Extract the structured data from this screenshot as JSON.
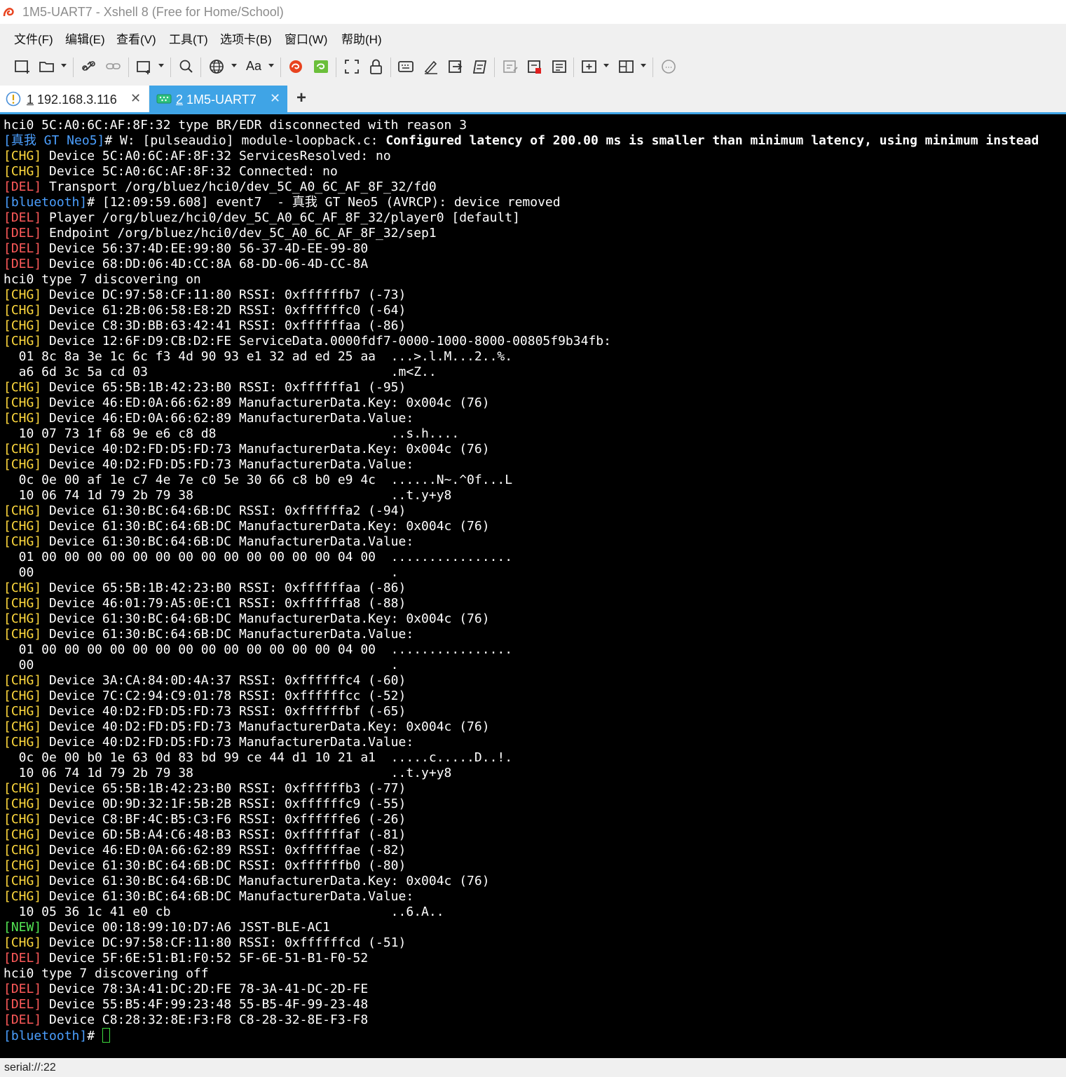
{
  "window": {
    "title": "1M5-UART7 - Xshell 8 (Free for Home/School)",
    "app_icon": "xshell-snail-icon"
  },
  "menu": [
    {
      "label": "文件(F)"
    },
    {
      "label": "编辑(E)"
    },
    {
      "label": "查看(V)"
    },
    {
      "label": "工具(T)"
    },
    {
      "label": "选项卡(B)"
    },
    {
      "label": "窗口(W)"
    },
    {
      "label": "帮助(H)"
    }
  ],
  "toolbar": {
    "font_label": "Aa"
  },
  "tabs": [
    {
      "number": "1",
      "label": "192.168.3.116",
      "icon": "warning-circle-icon",
      "active": false
    },
    {
      "number": "2",
      "label": "1M5-UART7",
      "icon": "serial-port-icon",
      "active": true
    }
  ],
  "tab_add": "+",
  "terminal": {
    "lines": [
      [
        {
          "t": "hci0 5C:A0:6C:AF:8F:32 type BR/EDR disconnected with reason 3"
        }
      ],
      [
        {
          "t": "[真我 GT Neo5]",
          "c": "blue"
        },
        {
          "t": "# W: [pulseaudio] module-loopback.c: "
        },
        {
          "t": "Configured latency of 200.00 ms is smaller than minimum latency, using minimum instead",
          "b": true
        }
      ],
      [
        {
          "t": "[CHG]",
          "c": "yellow"
        },
        {
          "t": " Device 5C:A0:6C:AF:8F:32 ServicesResolved: no"
        }
      ],
      [
        {
          "t": "[CHG]",
          "c": "yellow"
        },
        {
          "t": " Device 5C:A0:6C:AF:8F:32 Connected: no"
        }
      ],
      [
        {
          "t": "[DEL]",
          "c": "red"
        },
        {
          "t": " Transport /org/bluez/hci0/dev_5C_A0_6C_AF_8F_32/fd0"
        }
      ],
      [
        {
          "t": "[bluetooth]",
          "c": "blue"
        },
        {
          "t": "# [12:09:59.608] event7  - 真我 GT Neo5 (AVRCP): device removed"
        }
      ],
      [
        {
          "t": "[DEL]",
          "c": "red"
        },
        {
          "t": " Player /org/bluez/hci0/dev_5C_A0_6C_AF_8F_32/player0 [default]"
        }
      ],
      [
        {
          "t": "[DEL]",
          "c": "red"
        },
        {
          "t": " Endpoint /org/bluez/hci0/dev_5C_A0_6C_AF_8F_32/sep1"
        }
      ],
      [
        {
          "t": "[DEL]",
          "c": "red"
        },
        {
          "t": " Device 56:37:4D:EE:99:80 56-37-4D-EE-99-80"
        }
      ],
      [
        {
          "t": "[DEL]",
          "c": "red"
        },
        {
          "t": " Device 68:DD:06:4D:CC:8A 68-DD-06-4D-CC-8A"
        }
      ],
      [
        {
          "t": "hci0 type 7 discovering on"
        }
      ],
      [
        {
          "t": "[CHG]",
          "c": "yellow"
        },
        {
          "t": " Device DC:97:58:CF:11:80 RSSI: 0xffffffb7 (-73)"
        }
      ],
      [
        {
          "t": "[CHG]",
          "c": "yellow"
        },
        {
          "t": " Device 61:2B:06:58:E8:2D RSSI: 0xffffffc0 (-64)"
        }
      ],
      [
        {
          "t": "[CHG]",
          "c": "yellow"
        },
        {
          "t": " Device C8:3D:BB:63:42:41 RSSI: 0xffffffaa (-86)"
        }
      ],
      [
        {
          "t": "[CHG]",
          "c": "yellow"
        },
        {
          "t": " Device 12:6F:D9:CB:D2:FE ServiceData.0000fdf7-0000-1000-8000-00805f9b34fb:"
        }
      ],
      [
        {
          "t": "  01 8c 8a 3e 1c 6c f3 4d 90 93 e1 32 ad ed 25 aa  ...>.l.M...2..%."
        }
      ],
      [
        {
          "t": "  a6 6d 3c 5a cd 03                                .m<Z.."
        }
      ],
      [
        {
          "t": "[CHG]",
          "c": "yellow"
        },
        {
          "t": " Device 65:5B:1B:42:23:B0 RSSI: 0xffffffa1 (-95)"
        }
      ],
      [
        {
          "t": "[CHG]",
          "c": "yellow"
        },
        {
          "t": " Device 46:ED:0A:66:62:89 ManufacturerData.Key: 0x004c (76)"
        }
      ],
      [
        {
          "t": "[CHG]",
          "c": "yellow"
        },
        {
          "t": " Device 46:ED:0A:66:62:89 ManufacturerData.Value:"
        }
      ],
      [
        {
          "t": "  10 07 73 1f 68 9e e6 c8 d8                       ..s.h...."
        }
      ],
      [
        {
          "t": "[CHG]",
          "c": "yellow"
        },
        {
          "t": " Device 40:D2:FD:D5:FD:73 ManufacturerData.Key: 0x004c (76)"
        }
      ],
      [
        {
          "t": "[CHG]",
          "c": "yellow"
        },
        {
          "t": " Device 40:D2:FD:D5:FD:73 ManufacturerData.Value:"
        }
      ],
      [
        {
          "t": "  0c 0e 00 af 1e c7 4e 7e c0 5e 30 66 c8 b0 e9 4c  ......N~.^0f...L"
        }
      ],
      [
        {
          "t": "  10 06 74 1d 79 2b 79 38                          ..t.y+y8"
        }
      ],
      [
        {
          "t": "[CHG]",
          "c": "yellow"
        },
        {
          "t": " Device 61:30:BC:64:6B:DC RSSI: 0xffffffa2 (-94)"
        }
      ],
      [
        {
          "t": "[CHG]",
          "c": "yellow"
        },
        {
          "t": " Device 61:30:BC:64:6B:DC ManufacturerData.Key: 0x004c (76)"
        }
      ],
      [
        {
          "t": "[CHG]",
          "c": "yellow"
        },
        {
          "t": " Device 61:30:BC:64:6B:DC ManufacturerData.Value:"
        }
      ],
      [
        {
          "t": "  01 00 00 00 00 00 00 00 00 00 00 00 00 00 04 00  ................"
        }
      ],
      [
        {
          "t": "  00                                               ."
        }
      ],
      [
        {
          "t": "[CHG]",
          "c": "yellow"
        },
        {
          "t": " Device 65:5B:1B:42:23:B0 RSSI: 0xffffffaa (-86)"
        }
      ],
      [
        {
          "t": "[CHG]",
          "c": "yellow"
        },
        {
          "t": " Device 46:01:79:A5:0E:C1 RSSI: 0xffffffa8 (-88)"
        }
      ],
      [
        {
          "t": "[CHG]",
          "c": "yellow"
        },
        {
          "t": " Device 61:30:BC:64:6B:DC ManufacturerData.Key: 0x004c (76)"
        }
      ],
      [
        {
          "t": "[CHG]",
          "c": "yellow"
        },
        {
          "t": " Device 61:30:BC:64:6B:DC ManufacturerData.Value:"
        }
      ],
      [
        {
          "t": "  01 00 00 00 00 00 00 00 00 00 00 00 00 00 04 00  ................"
        }
      ],
      [
        {
          "t": "  00                                               ."
        }
      ],
      [
        {
          "t": "[CHG]",
          "c": "yellow"
        },
        {
          "t": " Device 3A:CA:84:0D:4A:37 RSSI: 0xffffffc4 (-60)"
        }
      ],
      [
        {
          "t": "[CHG]",
          "c": "yellow"
        },
        {
          "t": " Device 7C:C2:94:C9:01:78 RSSI: 0xffffffcc (-52)"
        }
      ],
      [
        {
          "t": "[CHG]",
          "c": "yellow"
        },
        {
          "t": " Device 40:D2:FD:D5:FD:73 RSSI: 0xffffffbf (-65)"
        }
      ],
      [
        {
          "t": "[CHG]",
          "c": "yellow"
        },
        {
          "t": " Device 40:D2:FD:D5:FD:73 ManufacturerData.Key: 0x004c (76)"
        }
      ],
      [
        {
          "t": "[CHG]",
          "c": "yellow"
        },
        {
          "t": " Device 40:D2:FD:D5:FD:73 ManufacturerData.Value:"
        }
      ],
      [
        {
          "t": "  0c 0e 00 b0 1e 63 0d 83 bd 99 ce 44 d1 10 21 a1  .....c.....D..!."
        }
      ],
      [
        {
          "t": "  10 06 74 1d 79 2b 79 38                          ..t.y+y8"
        }
      ],
      [
        {
          "t": "[CHG]",
          "c": "yellow"
        },
        {
          "t": " Device 65:5B:1B:42:23:B0 RSSI: 0xffffffb3 (-77)"
        }
      ],
      [
        {
          "t": "[CHG]",
          "c": "yellow"
        },
        {
          "t": " Device 0D:9D:32:1F:5B:2B RSSI: 0xffffffc9 (-55)"
        }
      ],
      [
        {
          "t": "[CHG]",
          "c": "yellow"
        },
        {
          "t": " Device C8:BF:4C:B5:C3:F6 RSSI: 0xffffffe6 (-26)"
        }
      ],
      [
        {
          "t": "[CHG]",
          "c": "yellow"
        },
        {
          "t": " Device 6D:5B:A4:C6:48:B3 RSSI: 0xffffffaf (-81)"
        }
      ],
      [
        {
          "t": "[CHG]",
          "c": "yellow"
        },
        {
          "t": " Device 46:ED:0A:66:62:89 RSSI: 0xffffffae (-82)"
        }
      ],
      [
        {
          "t": "[CHG]",
          "c": "yellow"
        },
        {
          "t": " Device 61:30:BC:64:6B:DC RSSI: 0xffffffb0 (-80)"
        }
      ],
      [
        {
          "t": "[CHG]",
          "c": "yellow"
        },
        {
          "t": " Device 61:30:BC:64:6B:DC ManufacturerData.Key: 0x004c (76)"
        }
      ],
      [
        {
          "t": "[CHG]",
          "c": "yellow"
        },
        {
          "t": " Device 61:30:BC:64:6B:DC ManufacturerData.Value:"
        }
      ],
      [
        {
          "t": "  10 05 36 1c 41 e0 cb                             ..6.A.."
        }
      ],
      [
        {
          "t": "[NEW]",
          "c": "green"
        },
        {
          "t": " Device 00:18:99:10:D7:A6 JSST-BLE-AC1"
        }
      ],
      [
        {
          "t": "[CHG]",
          "c": "yellow"
        },
        {
          "t": " Device DC:97:58:CF:11:80 RSSI: 0xffffffcd (-51)"
        }
      ],
      [
        {
          "t": "[DEL]",
          "c": "red"
        },
        {
          "t": " Device 5F:6E:51:B1:F0:52 5F-6E-51-B1-F0-52"
        }
      ],
      [
        {
          "t": "hci0 type 7 discovering off"
        }
      ],
      [
        {
          "t": "[DEL]",
          "c": "red"
        },
        {
          "t": " Device 78:3A:41:DC:2D:FE 78-3A-41-DC-2D-FE"
        }
      ],
      [
        {
          "t": "[DEL]",
          "c": "red"
        },
        {
          "t": " Device 55:B5:4F:99:23:48 55-B5-4F-99-23-48"
        }
      ],
      [
        {
          "t": "[DEL]",
          "c": "red"
        },
        {
          "t": " Device C8:28:32:8E:F3:F8 C8-28-32-8E-F3-F8"
        }
      ],
      [
        {
          "t": "[bluetooth]",
          "c": "blue"
        },
        {
          "t": "# "
        }
      ]
    ]
  },
  "status": {
    "text": "serial://:22"
  },
  "colors": {
    "prompt_blue": "#4b9fff",
    "chg_yellow": "#ffd93d",
    "del_red": "#ff5a5a",
    "new_green": "#54e654",
    "tab_active": "#3fa4e6"
  }
}
